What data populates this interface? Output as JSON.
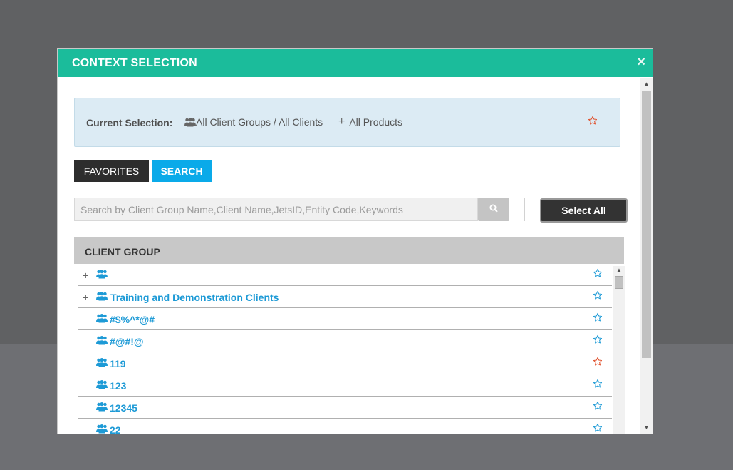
{
  "modal": {
    "title": "CONTEXT SELECTION",
    "close_symbol": "×"
  },
  "current_selection": {
    "label": "Current Selection:",
    "clients_text": "All Client Groups / All Clients",
    "products_text": "All Products",
    "favorite_star_color": "#e0522e"
  },
  "tabs": [
    {
      "label": "FAVORITES",
      "active": false
    },
    {
      "label": "SEARCH",
      "active": true
    }
  ],
  "search": {
    "placeholder": "Search by Client Group Name,Client Name,JetsID,Entity Code,Keywords",
    "value": ""
  },
  "select_all_label": "Select All",
  "list": {
    "header": "CLIENT GROUP",
    "rows": [
      {
        "name": "",
        "expandable": true,
        "favorite": false
      },
      {
        "name": "Training and Demonstration Clients",
        "expandable": true,
        "favorite": false
      },
      {
        "name": "#$%^*@#",
        "expandable": false,
        "favorite": false
      },
      {
        "name": "#@#!@",
        "expandable": false,
        "favorite": false
      },
      {
        "name": "119",
        "expandable": false,
        "favorite": true
      },
      {
        "name": "123",
        "expandable": false,
        "favorite": false
      },
      {
        "name": "12345",
        "expandable": false,
        "favorite": false
      },
      {
        "name": "22",
        "expandable": false,
        "favorite": false
      }
    ]
  },
  "colors": {
    "accent": "#1bbc9b",
    "tab_active": "#0aaae9",
    "link": "#1d9ad6",
    "star_default": "#1d9ad6",
    "star_favorite": "#e0522e"
  }
}
